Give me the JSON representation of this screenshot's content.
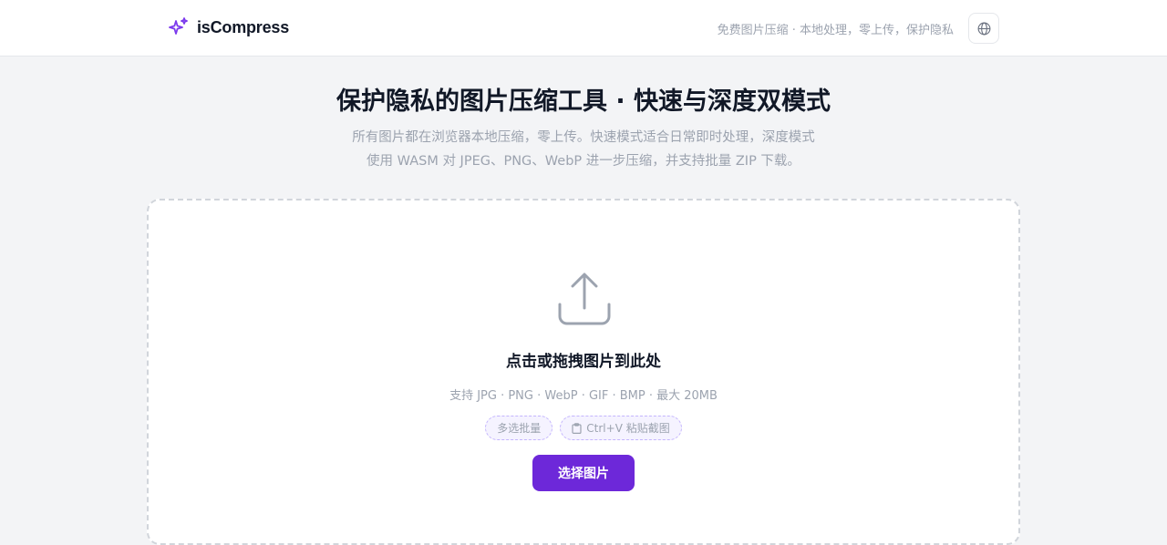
{
  "header": {
    "brand": "isCompress",
    "tagline": "免费图片压缩 · 本地处理，零上传，保护隐私",
    "language_icon": "globe-icon",
    "brand_icon": "sparkles-icon"
  },
  "hero": {
    "title": "保护隐私的图片压缩工具 · 快速与深度双模式",
    "description": "所有图片都在浏览器本地压缩，零上传。快速模式适合日常即时处理，深度模式使用 WASM 对 JPEG、PNG、WebP 进一步压缩，并支持批量 ZIP 下载。"
  },
  "dropzone": {
    "icon": "upload-icon",
    "title": "点击或拖拽图片到此处",
    "formats": "支持 JPG · PNG · WebP · GIF · BMP · 最大 20MB",
    "chips": [
      "多选批量",
      "Ctrl+V 粘贴截图"
    ],
    "button": "选择图片"
  },
  "colors": {
    "accent": "#6d28d9",
    "background": "#f3f4f6"
  }
}
